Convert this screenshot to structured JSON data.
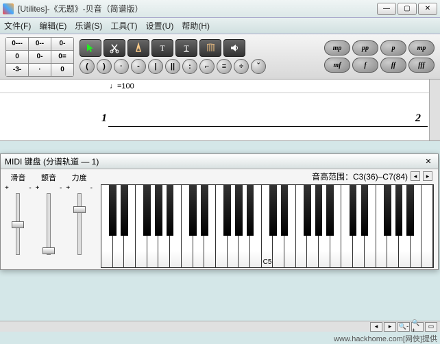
{
  "title": "[Utilites]-《无题》-贝音（简谱版）",
  "menu": [
    "文件(F)",
    "编辑(E)",
    "乐谱(S)",
    "工具(T)",
    "设置(U)",
    "帮助(H)"
  ],
  "numpad": [
    "0---",
    "0--",
    "0-",
    "0",
    "0-",
    "0=",
    "-3-",
    "·",
    "0"
  ],
  "tools_top": [
    "arrow",
    "cut",
    "tempo",
    "text",
    "lyric",
    "harp",
    "speaker"
  ],
  "circles": [
    "(",
    ")",
    "·",
    "-",
    "|",
    "||",
    ":",
    "⌐",
    "≡",
    "÷",
    "ˇ"
  ],
  "dynamics_top": [
    "mp",
    "pp",
    "p",
    "mp"
  ],
  "dynamics_bot": [
    "mf",
    "f",
    "ff",
    "fff"
  ],
  "tempo": "=100",
  "bar1": "1",
  "bar2": "2",
  "midi": {
    "title": "MIDI 键盘 (分谱轨道 — 1)",
    "sliders": [
      "滑音",
      "颤音",
      "力度"
    ],
    "range_label": "音高范围：C3(36)–C7(84)",
    "c5": "C5"
  },
  "footer": "www.hackhome.com[网侠]提供",
  "chart_data": {
    "type": "table",
    "title": "MIDI keyboard range",
    "note_low": "C3",
    "midi_low": 36,
    "note_high": "C7",
    "midi_high": 84,
    "tempo_bpm": 100
  }
}
